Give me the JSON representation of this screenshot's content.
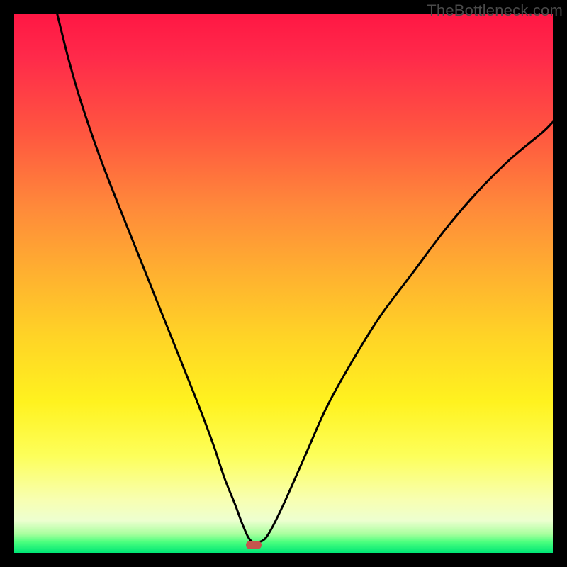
{
  "watermark": {
    "text": "TheBottleneck.com"
  },
  "marker": {
    "x_frac": 0.445,
    "y_frac": 0.985
  },
  "chart_data": {
    "type": "line",
    "title": "",
    "xlabel": "",
    "ylabel": "",
    "xlim": [
      0,
      100
    ],
    "ylim": [
      0,
      100
    ],
    "grid": false,
    "legend": null,
    "annotations": [],
    "series": [
      {
        "name": "curve",
        "x": [
          8,
          10,
          12,
          15,
          18,
          22,
          26,
          30,
          34,
          37,
          39,
          41,
          42.5,
          44,
          46,
          47.5,
          50,
          54,
          58,
          63,
          68,
          74,
          80,
          86,
          92,
          98,
          100
        ],
        "y": [
          100,
          92,
          85,
          76,
          68,
          58,
          48,
          38,
          28,
          20,
          14,
          9,
          5,
          2.2,
          2.2,
          4,
          9,
          18,
          27,
          36,
          44,
          52,
          60,
          67,
          73,
          78,
          80
        ]
      }
    ],
    "background_gradient": {
      "direction": "vertical",
      "stops": [
        {
          "pos": 0.0,
          "color": "#ff1744"
        },
        {
          "pos": 0.22,
          "color": "#ff5640"
        },
        {
          "pos": 0.48,
          "color": "#ffb030"
        },
        {
          "pos": 0.72,
          "color": "#fff21f"
        },
        {
          "pos": 0.9,
          "color": "#f8ffb0"
        },
        {
          "pos": 0.97,
          "color": "#4cff7e"
        },
        {
          "pos": 1.0,
          "color": "#00e676"
        }
      ]
    },
    "marker": {
      "x": 44.5,
      "y": 1.5,
      "color": "#c4554d",
      "shape": "pill"
    }
  }
}
